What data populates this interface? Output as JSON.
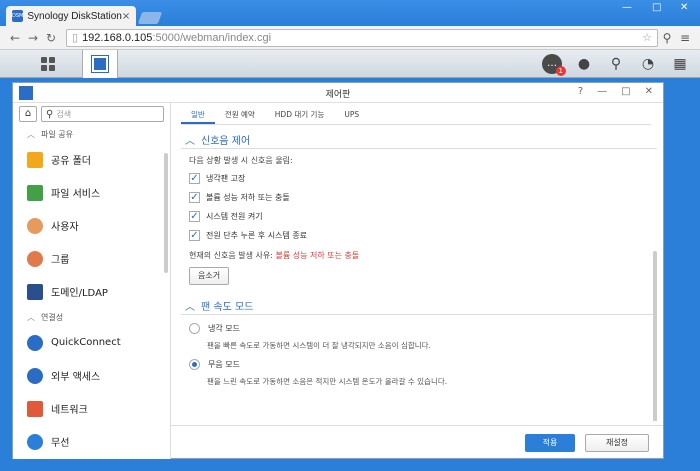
{
  "browser": {
    "tab_title": "Synology DiskStation",
    "favicon_text": "DSM",
    "url_host": "192.168.0.105",
    "url_rest": ":5000/webman/index.cgi",
    "window_controls": [
      "—",
      "□",
      "✕"
    ]
  },
  "taskbar": {
    "notification_count": "1"
  },
  "window": {
    "title": "제어판",
    "buttons": [
      "?",
      "—",
      "□",
      "✕"
    ]
  },
  "sidebar": {
    "search_placeholder": "검색",
    "section_file_sharing": "파일 공유",
    "items_file": [
      {
        "label": "공유 폴더",
        "color": "#f2a81d"
      },
      {
        "label": "파일 서비스",
        "color": "#43a047"
      },
      {
        "label": "사용자",
        "color": "#e69a5b"
      },
      {
        "label": "그룹",
        "color": "#e07a4a"
      },
      {
        "label": "도메인/LDAP",
        "color": "#2b4f8c"
      }
    ],
    "section_connectivity": "연결성",
    "items_conn": [
      {
        "label": "QuickConnect",
        "color": "#2b6cc4"
      },
      {
        "label": "외부 액세스",
        "color": "#2b6cc4"
      },
      {
        "label": "네트워크",
        "color": "#e05a3a"
      },
      {
        "label": "무선",
        "color": "#2b7fd8"
      }
    ]
  },
  "tabs": [
    {
      "label": "일반",
      "active": true
    },
    {
      "label": "전원 예약",
      "active": false
    },
    {
      "label": "HDD 대기 기능",
      "active": false
    },
    {
      "label": "UPS",
      "active": false
    }
  ],
  "beep": {
    "heading": "신호음 제어",
    "intro": "다음 상황 발생 시 신호음 울림:",
    "options": [
      {
        "label": "냉각팬 고장",
        "checked": true
      },
      {
        "label": "볼륨 성능 저하 또는 충돌",
        "checked": true
      },
      {
        "label": "시스템 전원 켜기",
        "checked": true
      },
      {
        "label": "전원 단추 누른 후 시스템 종료",
        "checked": true
      }
    ],
    "reason_label": "현재의 신호음 발생 사유:",
    "reason_value": "볼륨 성능 저하 또는 충돌",
    "mute_button": "음소거"
  },
  "fan": {
    "heading": "팬 속도 모드",
    "options": [
      {
        "label": "냉각 모드",
        "desc": "팬을 빠른 속도로 가동하면 시스템이 더 잘 냉각되지만 소음이 심합니다.",
        "selected": false
      },
      {
        "label": "무음 모드",
        "desc": "팬을 느린 속도로 가동하면 소음은 적지만 시스템 온도가 올라갈 수 있습니다.",
        "selected": true
      }
    ]
  },
  "footer": {
    "apply": "적용",
    "reset": "재설정"
  }
}
